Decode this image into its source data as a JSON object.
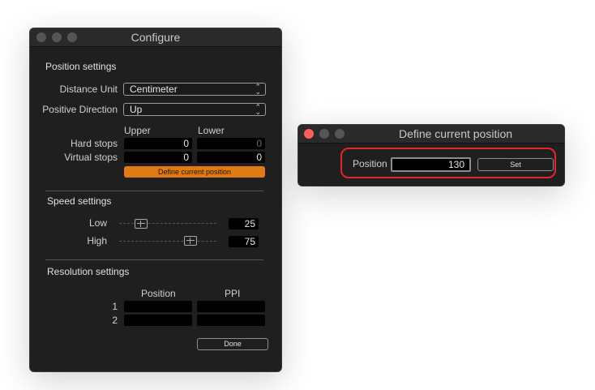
{
  "configure": {
    "title": "Configure",
    "position_settings": {
      "heading": "Position settings",
      "distance_unit_label": "Distance Unit",
      "distance_unit_value": "Centimeter",
      "positive_direction_label": "Positive Direction",
      "positive_direction_value": "Up",
      "upper_header": "Upper",
      "lower_header": "Lower",
      "hard_stops_label": "Hard stops",
      "hard_upper": "0",
      "hard_lower": "0",
      "virtual_stops_label": "Virtual stops",
      "virtual_upper": "0",
      "virtual_lower": "0",
      "define_button": "Define current position"
    },
    "speed_settings": {
      "heading": "Speed settings",
      "low_label": "Low",
      "low_value": "25",
      "high_label": "High",
      "high_value": "75"
    },
    "resolution_settings": {
      "heading": "Resolution settings",
      "position_header": "Position",
      "ppi_header": "PPI",
      "row1_label": "1",
      "row2_label": "2"
    },
    "done_button": "Done"
  },
  "define": {
    "title": "Define current position",
    "position_label": "Position",
    "position_value": "130",
    "set_button": "Set"
  }
}
